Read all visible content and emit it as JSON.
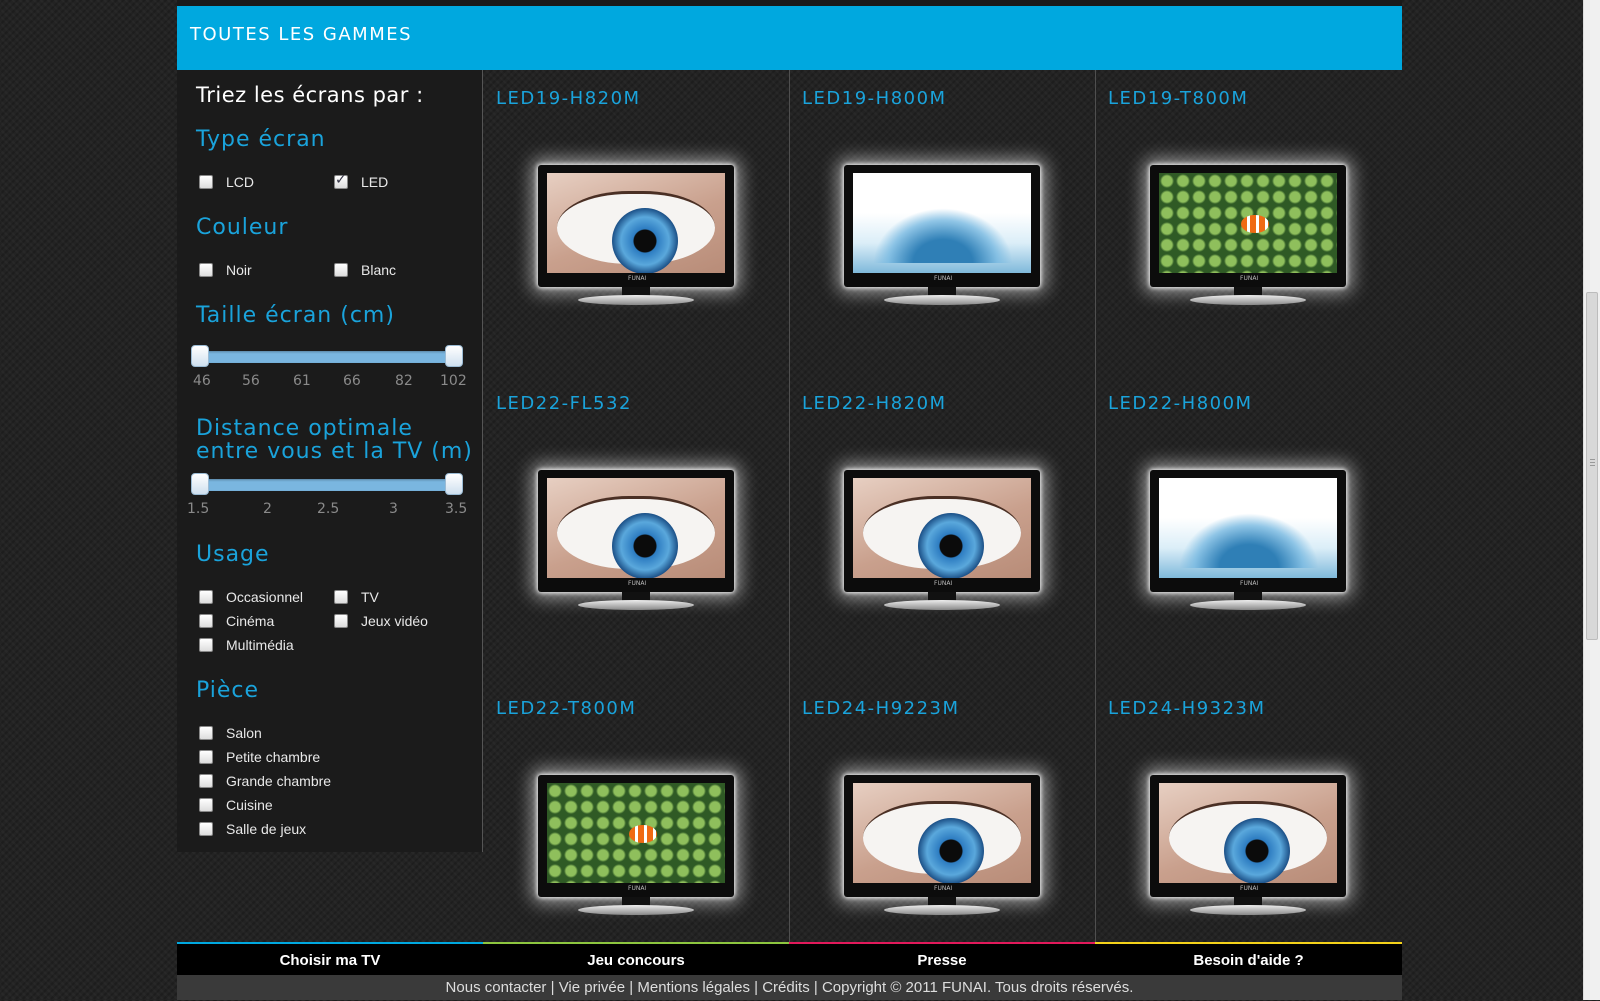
{
  "header": {
    "title": "TOUTES LES GAMMES"
  },
  "sidebar": {
    "title": "Triez les écrans par :",
    "type_ecran": {
      "heading": "Type écran",
      "options": [
        {
          "label": "LCD",
          "checked": false
        },
        {
          "label": "LED",
          "checked": true
        }
      ]
    },
    "couleur": {
      "heading": "Couleur",
      "options": [
        {
          "label": "Noir",
          "checked": false
        },
        {
          "label": "Blanc",
          "checked": false
        }
      ]
    },
    "taille": {
      "heading": "Taille écran (cm)",
      "ticks": [
        "46",
        "56",
        "61",
        "66",
        "82",
        "102"
      ],
      "range": [
        "46",
        "102"
      ]
    },
    "distance": {
      "heading": "Distance optimale entre vous et la TV (m)",
      "ticks": [
        "1.5",
        "2",
        "2.5",
        "3",
        "3.5"
      ],
      "range": [
        "1.5",
        "3.5"
      ]
    },
    "usage": {
      "heading": "Usage",
      "options": [
        {
          "label": "Occasionnel",
          "checked": false
        },
        {
          "label": "TV",
          "checked": false
        },
        {
          "label": "Cinéma",
          "checked": false
        },
        {
          "label": "Jeux vidéo",
          "checked": false
        },
        {
          "label": "Multimédia",
          "checked": false
        }
      ]
    },
    "piece": {
      "heading": "Pièce",
      "options": [
        {
          "label": "Salon",
          "checked": false
        },
        {
          "label": "Petite chambre",
          "checked": false
        },
        {
          "label": "Grande chambre",
          "checked": false
        },
        {
          "label": "Cuisine",
          "checked": false
        },
        {
          "label": "Salle de jeux",
          "checked": false
        }
      ]
    }
  },
  "products": [
    {
      "name": "LED19-H820M",
      "screen": "eye"
    },
    {
      "name": "LED19-H800M",
      "screen": "water"
    },
    {
      "name": "LED19-T800M",
      "screen": "reef"
    },
    {
      "name": "LED22-FL532",
      "screen": "eye"
    },
    {
      "name": "LED22-H820M",
      "screen": "eye"
    },
    {
      "name": "LED22-H800M",
      "screen": "water"
    },
    {
      "name": "LED22-T800M",
      "screen": "reef"
    },
    {
      "name": "LED24-H9223M",
      "screen": "eye"
    },
    {
      "name": "LED24-H9323M",
      "screen": "eye"
    }
  ],
  "bottom_nav": [
    {
      "label": "Choisir ma TV",
      "color": "#00a8df"
    },
    {
      "label": "Jeu concours",
      "color": "#8dc63f"
    },
    {
      "label": "Presse",
      "color": "#e2195b"
    },
    {
      "label": "Besoin d'aide ?",
      "color": "#f4d21a"
    }
  ],
  "footer": {
    "links": [
      "Nous contacter",
      "Vie privée",
      "Mentions légales",
      "Crédits"
    ],
    "copyright": "Copyright © 2011 FUNAI. Tous droits réservés."
  },
  "tv_brand": "FUNAI",
  "colors": {
    "accent": "#00a8df",
    "heading": "#1aa3db",
    "background": "#232323"
  }
}
